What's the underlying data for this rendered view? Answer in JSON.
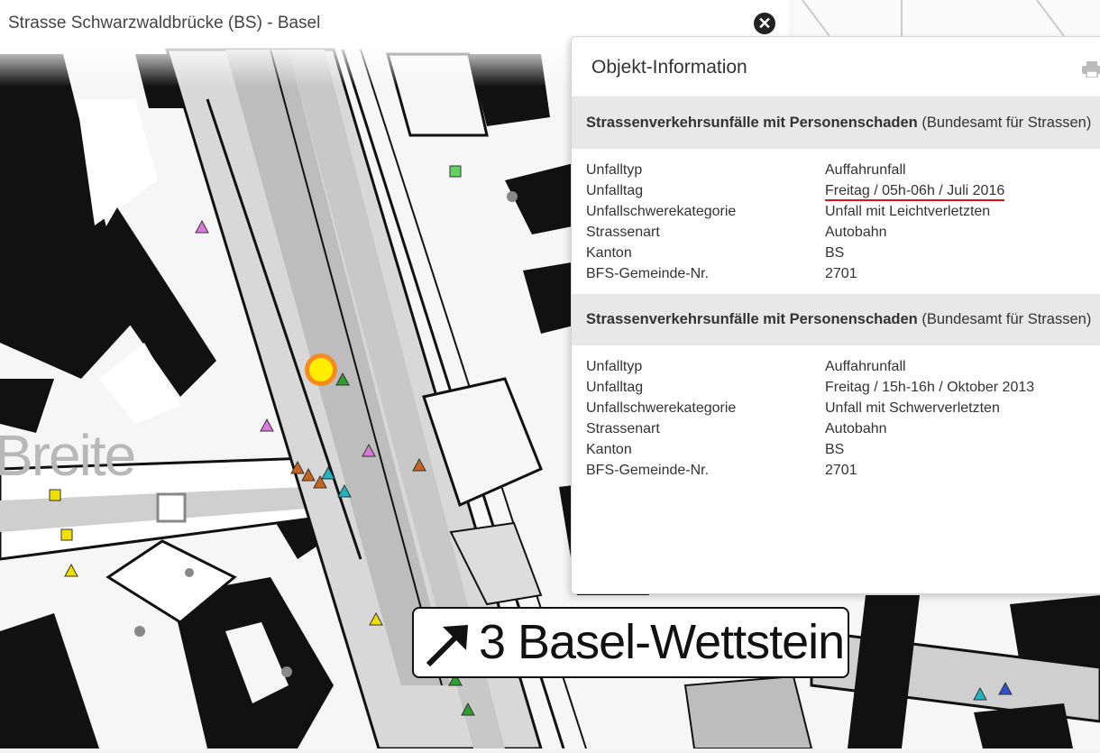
{
  "top_bar": {
    "title": "Strasse Schwarzwaldbrücke (BS) - Basel",
    "close_icon": "close-icon"
  },
  "map": {
    "place_label": "Breite",
    "exit_sign": {
      "arrow_icon": "arrow-up-right-icon",
      "text": "3 Basel-Wettstein"
    },
    "marker_colors": {
      "pink": "#d97ad9",
      "orange": "#c8641e",
      "cyan": "#1eb4c0",
      "green": "#2e9e2e",
      "yellow": "#f0e000",
      "blue": "#3050c8",
      "light_green": "#5fd45f",
      "selected_outer": "#f58a1f",
      "selected_inner": "#ffee00"
    }
  },
  "popup": {
    "title": "Objekt-Information",
    "print_icon": "print-icon",
    "highlight_color": "#e0101a",
    "sections": [
      {
        "heading_bold": "Strassenverkehrsunfälle mit Personenschaden",
        "heading_rest": " (Bundesamt für Strassen)",
        "rows": [
          {
            "key": "Unfalltyp",
            "value": "Auffahrunfall"
          },
          {
            "key": "Unfalltag",
            "value": "Freitag / 05h-06h / Juli 2016"
          },
          {
            "key": "Unfallschwerekategorie",
            "value": "Unfall mit Leichtverletzten"
          },
          {
            "key": "Strassenart",
            "value": "Autobahn"
          },
          {
            "key": "Kanton",
            "value": "BS"
          },
          {
            "key": "BFS-Gemeinde-Nr.",
            "value": "2701"
          }
        ]
      },
      {
        "heading_bold": "Strassenverkehrsunfälle mit Personenschaden",
        "heading_rest": " (Bundesamt für Strassen)",
        "rows": [
          {
            "key": "Unfalltyp",
            "value": "Auffahrunfall"
          },
          {
            "key": "Unfalltag",
            "value": "Freitag / 15h-16h / Oktober 2013"
          },
          {
            "key": "Unfallschwerekategorie",
            "value": "Unfall mit Schwerverletzten"
          },
          {
            "key": "Strassenart",
            "value": "Autobahn"
          },
          {
            "key": "Kanton",
            "value": "BS"
          },
          {
            "key": "BFS-Gemeinde-Nr.",
            "value": "2701"
          }
        ]
      }
    ]
  }
}
